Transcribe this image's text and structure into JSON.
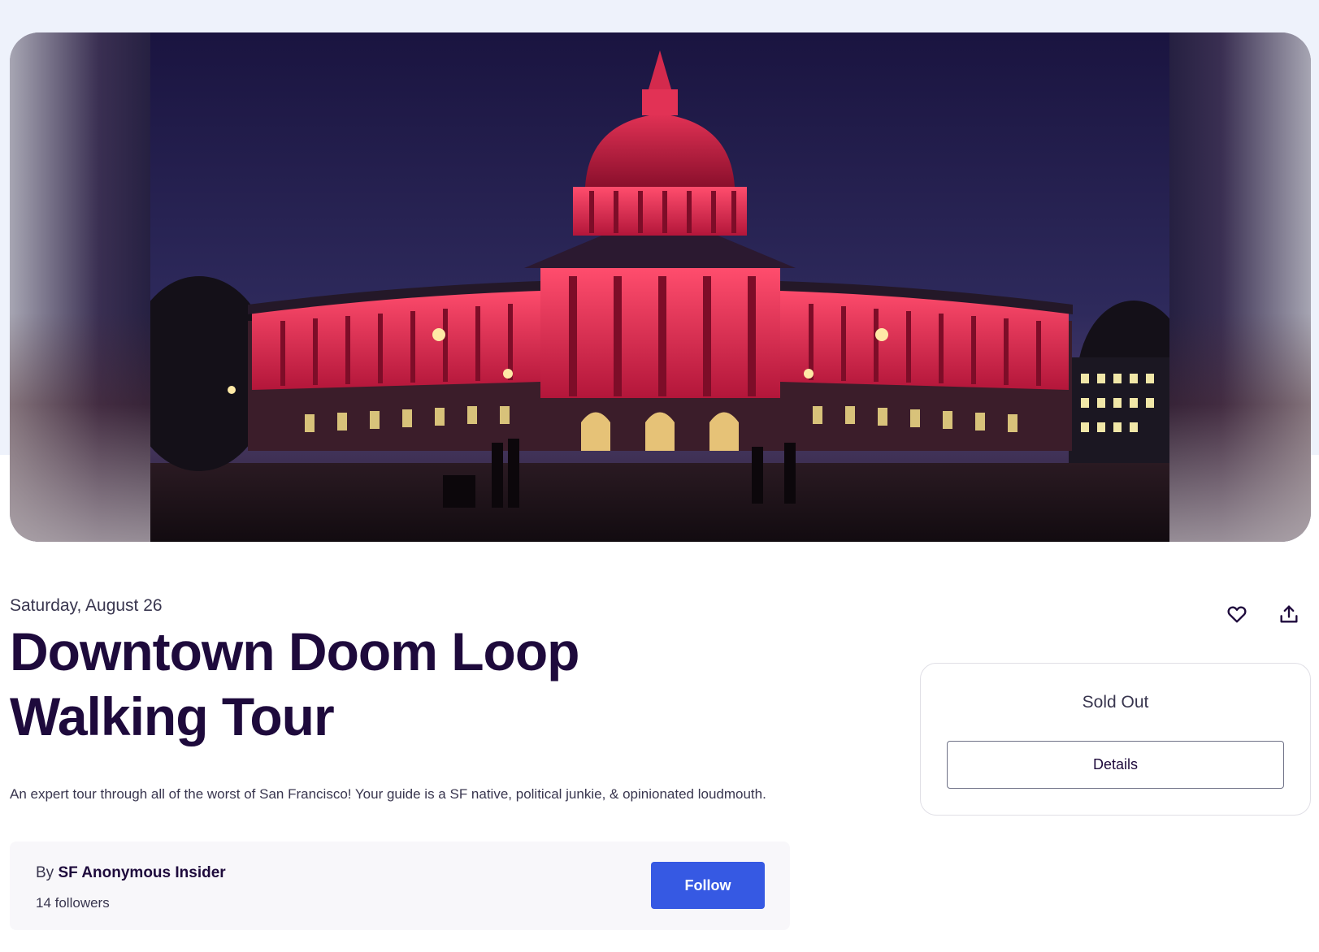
{
  "event": {
    "date": "Saturday, August 26",
    "title": "Downtown Doom Loop Walking Tour",
    "summary": "An expert tour through all of the worst of San Francisco! Your guide is a SF native, political junkie, & opinionated loudmouth."
  },
  "organizer": {
    "by_prefix": "By",
    "name": "SF Anonymous Insider",
    "followers": "14 followers",
    "follow_label": "Follow"
  },
  "actions": {
    "like_icon": "heart-icon",
    "share_icon": "share-upload-icon"
  },
  "ticket": {
    "status": "Sold Out",
    "details_label": "Details"
  },
  "colors": {
    "primary_text": "#1e0a3c",
    "secondary_text": "#39364f",
    "follow_button": "#3659e3",
    "hero_tint": "#eef2fb"
  }
}
